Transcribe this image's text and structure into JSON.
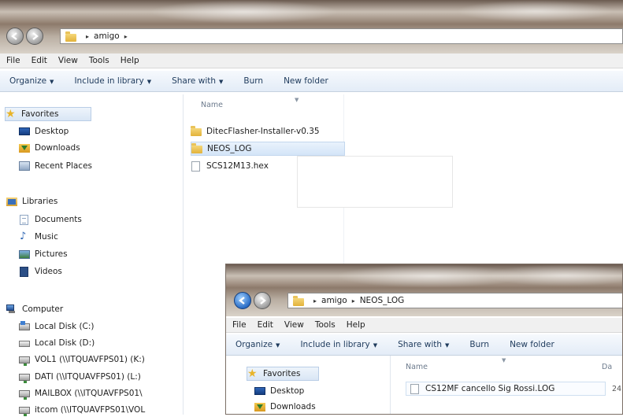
{
  "main": {
    "address": {
      "root_arrow": "▸",
      "crumbs": [
        "amigo"
      ],
      "trail_arrow": "▸"
    },
    "menu": [
      "File",
      "Edit",
      "View",
      "Tools",
      "Help"
    ],
    "toolbar": [
      {
        "label": "Organize",
        "dropdown": true
      },
      {
        "label": "Include in library",
        "dropdown": true
      },
      {
        "label": "Share with",
        "dropdown": true
      },
      {
        "label": "Burn",
        "dropdown": false
      },
      {
        "label": "New folder",
        "dropdown": false
      }
    ],
    "nav": {
      "favorites": {
        "label": "Favorites",
        "items": [
          "Desktop",
          "Downloads",
          "Recent Places"
        ]
      },
      "libraries": {
        "label": "Libraries",
        "items": [
          "Documents",
          "Music",
          "Pictures",
          "Videos"
        ]
      },
      "computer": {
        "label": "Computer",
        "items": [
          "Local Disk (C:)",
          "Local Disk (D:)",
          "VOL1 (\\\\ITQUAVFPS01) (K:)",
          "DATI (\\\\ITQUAVFPS01) (L:)",
          "MAILBOX (\\\\ITQUAVFPS01\\",
          "itcom (\\\\ITQUAVFPS01\\VOL"
        ]
      }
    },
    "column_name": "Name",
    "files": [
      {
        "name": "DitecFlasher-Installer-v0.35",
        "type": "folder"
      },
      {
        "name": "NEOS_LOG",
        "type": "folder",
        "selected": true
      },
      {
        "name": "SCS12M13.hex",
        "type": "file"
      }
    ]
  },
  "second": {
    "address": {
      "crumbs": [
        "amigo",
        "NEOS_LOG"
      ],
      "sep": "▸"
    },
    "menu": [
      "File",
      "Edit",
      "View",
      "Tools",
      "Help"
    ],
    "toolbar": [
      {
        "label": "Organize",
        "dropdown": true
      },
      {
        "label": "Include in library",
        "dropdown": true
      },
      {
        "label": "Share with",
        "dropdown": true
      },
      {
        "label": "Burn",
        "dropdown": false
      },
      {
        "label": "New folder",
        "dropdown": false
      }
    ],
    "nav": {
      "favorites": "Favorites",
      "items": [
        "Desktop",
        "Downloads"
      ]
    },
    "column_name": "Name",
    "column_date_partial": "Da",
    "files": [
      {
        "name": "CS12MF cancello Sig Rossi.LOG",
        "date_partial": "24"
      }
    ]
  },
  "colors": {
    "accent": "#1e3a5c",
    "selection": "#d4e5f8",
    "folder": "#e2b23a"
  }
}
